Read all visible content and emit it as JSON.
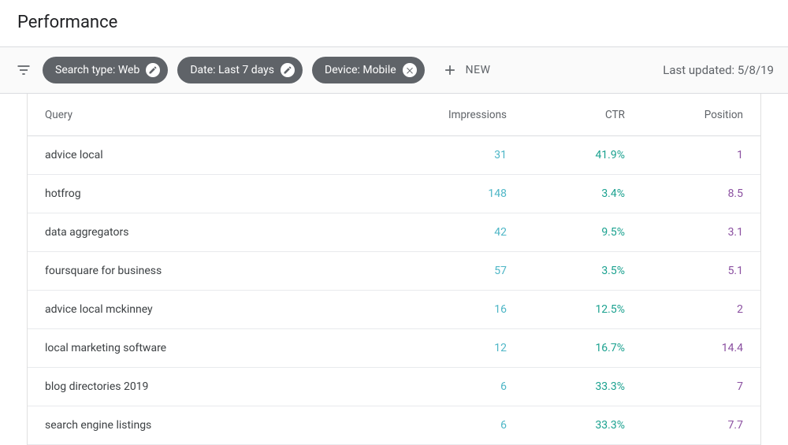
{
  "page_title": "Performance",
  "filters": {
    "search_type": "Search type: Web",
    "date": "Date: Last 7 days",
    "device": "Device: Mobile"
  },
  "new_button": "NEW",
  "last_updated_label": "Last updated: 5/8/19",
  "table": {
    "headers": {
      "query": "Query",
      "impressions": "Impressions",
      "ctr": "CTR",
      "position": "Position"
    },
    "rows": [
      {
        "query": "advice local",
        "impressions": "31",
        "ctr": "41.9%",
        "position": "1"
      },
      {
        "query": "hotfrog",
        "impressions": "148",
        "ctr": "3.4%",
        "position": "8.5"
      },
      {
        "query": "data aggregators",
        "impressions": "42",
        "ctr": "9.5%",
        "position": "3.1"
      },
      {
        "query": "foursquare for business",
        "impressions": "57",
        "ctr": "3.5%",
        "position": "5.1"
      },
      {
        "query": "advice local mckinney",
        "impressions": "16",
        "ctr": "12.5%",
        "position": "2"
      },
      {
        "query": "local marketing software",
        "impressions": "12",
        "ctr": "16.7%",
        "position": "14.4"
      },
      {
        "query": "blog directories 2019",
        "impressions": "6",
        "ctr": "33.3%",
        "position": "7"
      },
      {
        "query": "search engine listings",
        "impressions": "6",
        "ctr": "33.3%",
        "position": "7.7"
      }
    ]
  }
}
